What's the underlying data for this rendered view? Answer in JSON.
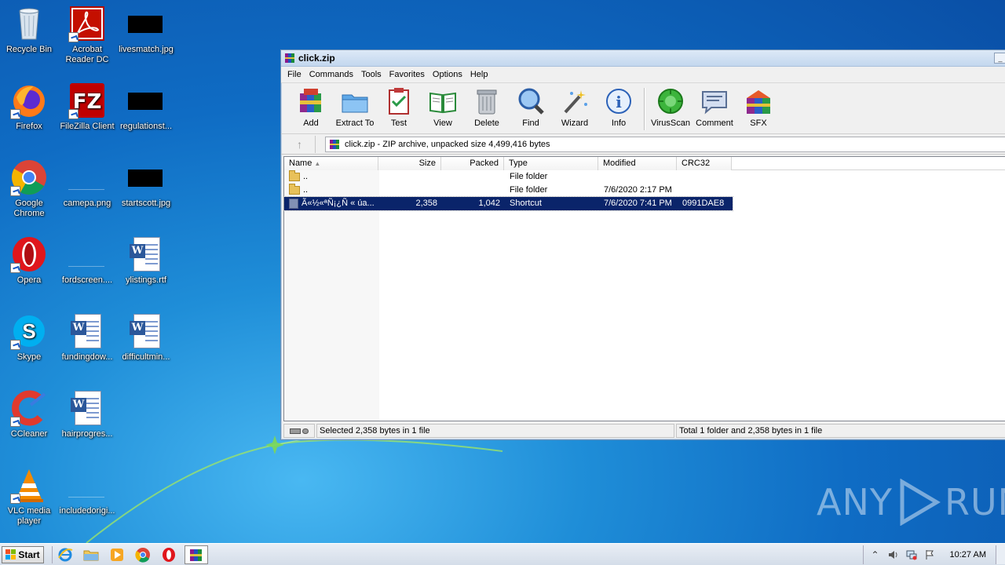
{
  "desktop": {
    "icons": [
      {
        "label": "Recycle Bin",
        "icon": "recycle-bin-icon"
      },
      {
        "label": "Acrobat Reader DC",
        "icon": "acrobat-icon"
      },
      {
        "label": "livesmatch.jpg",
        "icon": "image-file-icon"
      },
      {
        "label": "Firefox",
        "icon": "firefox-icon"
      },
      {
        "label": "FileZilla Client",
        "icon": "filezilla-icon"
      },
      {
        "label": "regulationst...",
        "icon": "image-file-icon"
      },
      {
        "label": "Google Chrome",
        "icon": "chrome-icon"
      },
      {
        "label": "camepa.png",
        "icon": "image-file-icon"
      },
      {
        "label": "startscott.jpg",
        "icon": "image-file-icon"
      },
      {
        "label": "Opera",
        "icon": "opera-icon"
      },
      {
        "label": "fordscreen....",
        "icon": "image-file-icon"
      },
      {
        "label": "ylistings.rtf",
        "icon": "word-doc-icon"
      },
      {
        "label": "Skype",
        "icon": "skype-icon"
      },
      {
        "label": "fundingdow...",
        "icon": "word-doc-icon"
      },
      {
        "label": "difficultmin...",
        "icon": "word-doc-icon"
      },
      {
        "label": "CCleaner",
        "icon": "ccleaner-icon"
      },
      {
        "label": "hairprogres...",
        "icon": "word-doc-icon"
      },
      {
        "label": "VLC media player",
        "icon": "vlc-icon"
      },
      {
        "label": "includedorigi...",
        "icon": "image-file-icon"
      }
    ]
  },
  "window": {
    "title": "click.zip",
    "menu": [
      "File",
      "Commands",
      "Tools",
      "Favorites",
      "Options",
      "Help"
    ],
    "toolbar": [
      {
        "label": "Add",
        "icon": "add-archive-icon"
      },
      {
        "label": "Extract To",
        "icon": "extract-folder-icon"
      },
      {
        "label": "Test",
        "icon": "test-clipboard-icon"
      },
      {
        "label": "View",
        "icon": "view-book-icon"
      },
      {
        "label": "Delete",
        "icon": "trash-can-icon"
      },
      {
        "label": "Find",
        "icon": "magnifier-icon"
      },
      {
        "label": "Wizard",
        "icon": "magic-wand-icon"
      },
      {
        "label": "Info",
        "icon": "info-icon"
      },
      {
        "label": "VirusScan",
        "icon": "virus-scan-icon"
      },
      {
        "label": "Comment",
        "icon": "comment-icon"
      },
      {
        "label": "SFX",
        "icon": "sfx-icon"
      }
    ],
    "address": "click.zip - ZIP archive, unpacked size 4,499,416 bytes",
    "columns": [
      "Name",
      "Size",
      "Packed",
      "Type",
      "Modified",
      "CRC32"
    ],
    "rows": [
      {
        "name": "..",
        "size": "",
        "packed": "",
        "type": "File folder",
        "modified": "",
        "crc": ""
      },
      {
        "name": "..",
        "size": "",
        "packed": "",
        "type": "File folder",
        "modified": "7/6/2020 2:17 PM",
        "crc": ""
      },
      {
        "name": "Ã«½«ªÑ¡¿Ñ « úa...",
        "size": "2,358",
        "packed": "1,042",
        "type": "Shortcut",
        "modified": "7/6/2020 7:41 PM",
        "crc": "0991DAE8"
      }
    ],
    "status_left": "Selected 2,358 bytes in 1 file",
    "status_right": "Total 1 folder and 2,358 bytes in 1 file"
  },
  "taskbar": {
    "start_label": "Start",
    "clock": "10:27 AM"
  },
  "watermark": {
    "left": "ANY",
    "right": "RUN"
  },
  "colors": {
    "selection": "#0a246a",
    "desktop_blue": "#0f6cc4"
  }
}
